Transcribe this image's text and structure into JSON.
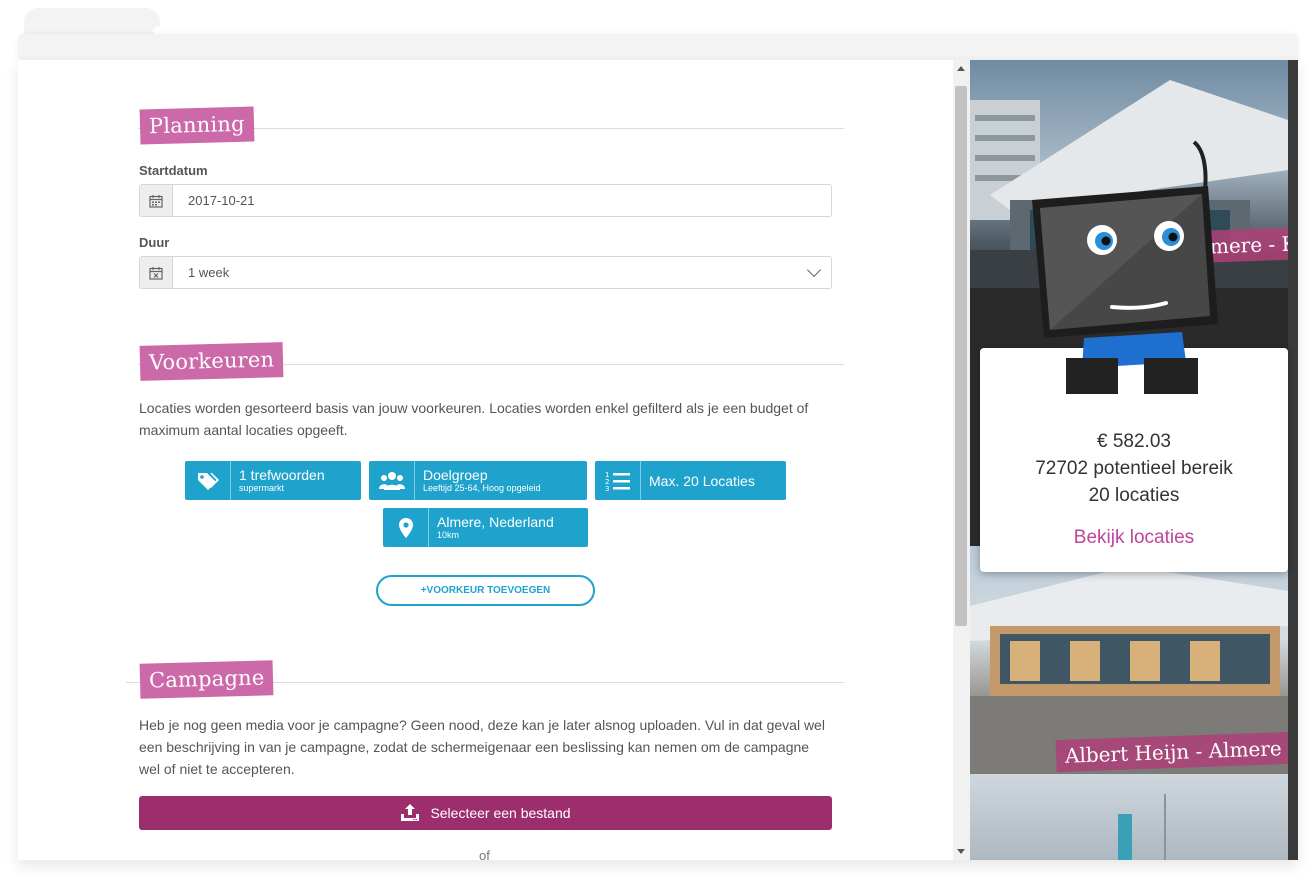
{
  "planning": {
    "heading": "Planning",
    "start_label": "Startdatum",
    "start_value": "2017-10-21",
    "duration_label": "Duur",
    "duration_value": "1 week"
  },
  "preferences": {
    "heading": "Voorkeuren",
    "description": "Locaties worden gesorteerd basis van jouw voorkeuren. Locaties worden enkel gefilterd als je een budget of maximum aantal locaties opgeeft.",
    "items": [
      {
        "icon": "tags-icon",
        "title": "1 trefwoorden",
        "subtitle": "supermarkt"
      },
      {
        "icon": "users-icon",
        "title": "Doelgroep",
        "subtitle": "Leeftijd 25-64, Hoog opgeleid"
      },
      {
        "icon": "list-numbered-icon",
        "title": "Max. 20 Locaties",
        "subtitle": ""
      },
      {
        "icon": "map-marker-icon",
        "title": "Almere, Nederland",
        "subtitle": "10km"
      }
    ],
    "add_button": "+VOORKEUR TOEVOEGEN"
  },
  "campaign": {
    "heading": "Campagne",
    "description": "Heb je nog geen media voor je campagne? Geen nood, deze kan je later alsnog uploaden. Vul in dat geval wel een beschrijving in van je campagne, zodat de schermeigenaar een beslissing kan nemen om de campagne wel of niet te accepteren.",
    "upload_button": "Selecteer een bestand",
    "or_text": "of"
  },
  "summary": {
    "price": "€ 582.03",
    "reach": "72702 potentieel bereik",
    "locations": "20 locaties",
    "link": "Bekijk locaties"
  },
  "locations": [
    {
      "name": "Almere - Kwartier"
    },
    {
      "name": "Albert Heijn - Almere"
    }
  ],
  "colors": {
    "section_ribbon": "#cc6aa9",
    "pref_chip": "#1fa3cc",
    "upload_button": "#9c2e6e",
    "link": "#c0449a"
  }
}
